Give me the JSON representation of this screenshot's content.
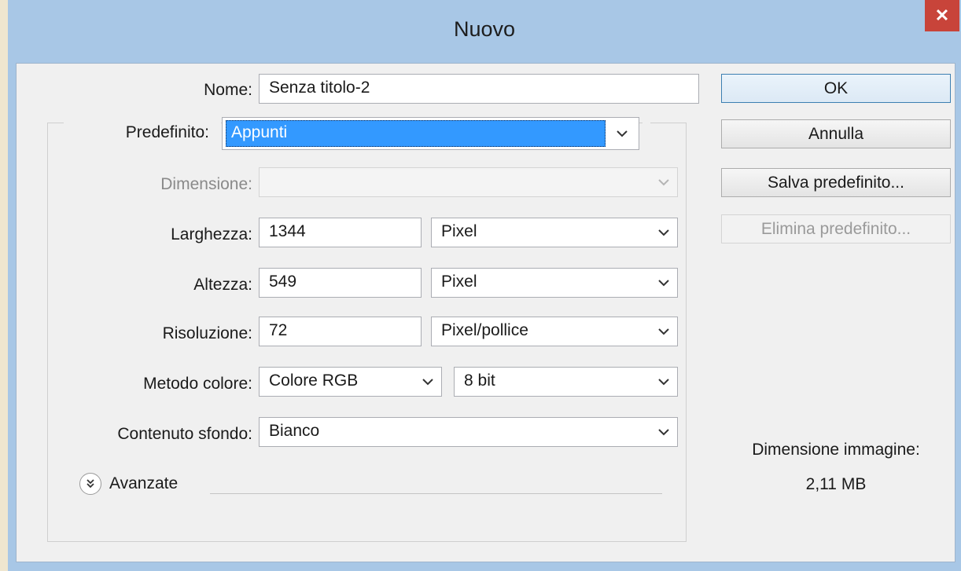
{
  "window": {
    "title": "Nuovo",
    "close_glyph": "✕"
  },
  "fields": {
    "name_label": "Nome:",
    "name_value": "Senza titolo-2",
    "preset_label": "Predefinito:",
    "preset_value": "Appunti",
    "size_label": "Dimensione:",
    "size_value": "",
    "width_label": "Larghezza:",
    "width_value": "1344",
    "width_unit": "Pixel",
    "height_label": "Altezza:",
    "height_value": "549",
    "height_unit": "Pixel",
    "resolution_label": "Risoluzione:",
    "resolution_value": "72",
    "resolution_unit": "Pixel/pollice",
    "color_mode_label": "Metodo colore:",
    "color_mode_value": "Colore RGB",
    "bit_depth_value": "8 bit",
    "background_label": "Contenuto sfondo:",
    "background_value": "Bianco",
    "advanced_label": "Avanzate"
  },
  "buttons": {
    "ok": "OK",
    "cancel": "Annulla",
    "save_preset": "Salva predefinito...",
    "delete_preset": "Elimina predefinito..."
  },
  "info": {
    "image_size_label": "Dimensione immagine:",
    "image_size_value": "2,11 MB"
  },
  "icons": {
    "close": "close-icon",
    "chevron": "chevron-down-icon",
    "expand": "double-chevron-down-icon"
  },
  "colors": {
    "titlebar": "#a8c7e6",
    "close_button": "#c8443a",
    "selection": "#3399ff"
  }
}
